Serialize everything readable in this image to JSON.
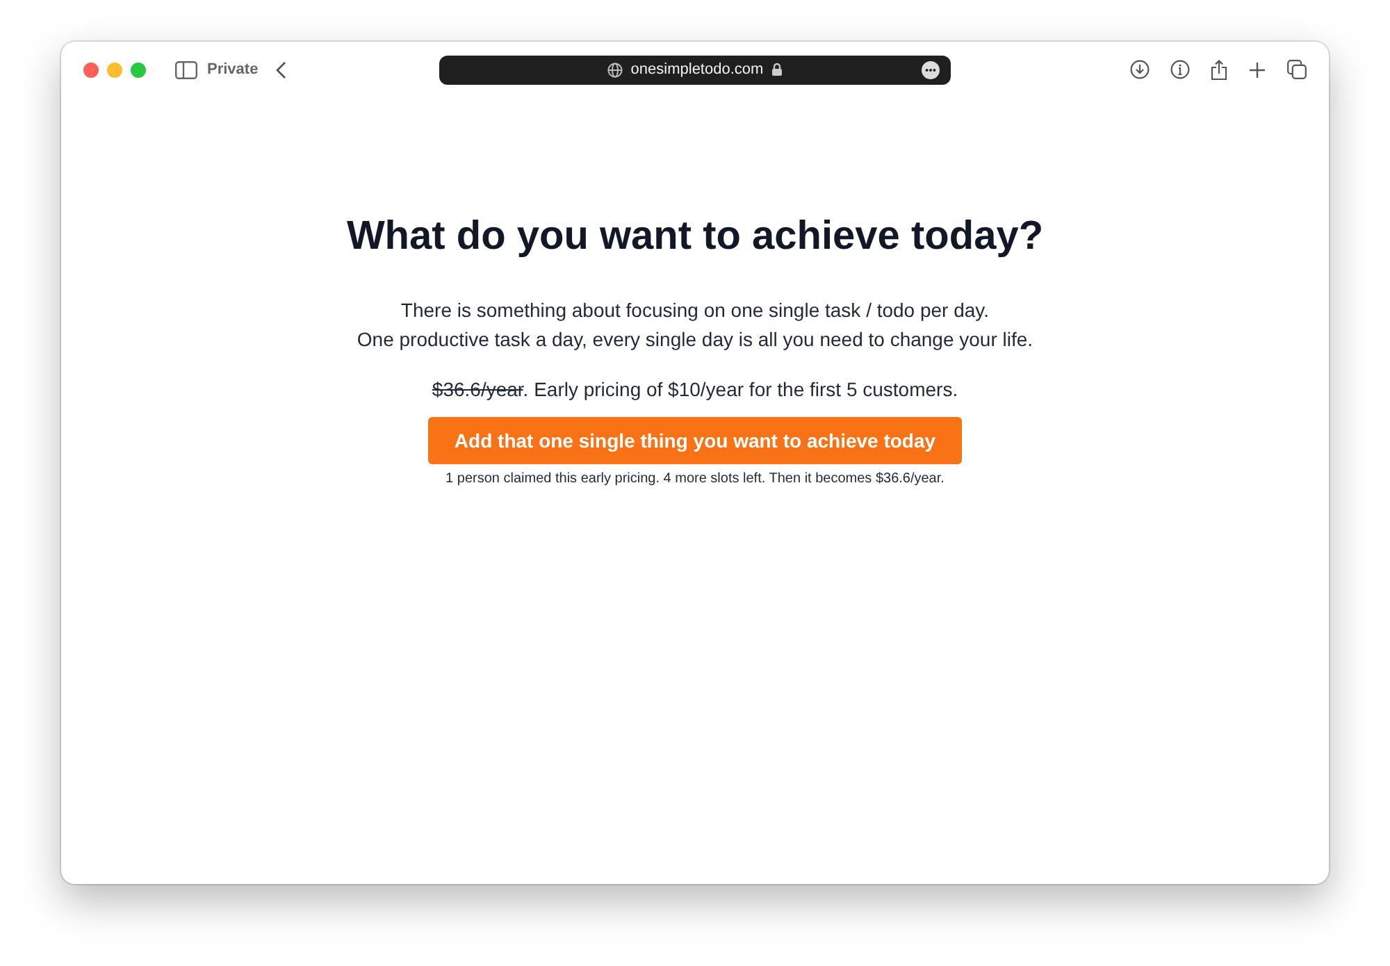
{
  "browser": {
    "private_label": "Private",
    "url": "onesimpletodo.com"
  },
  "page": {
    "heading": "What do you want to achieve today?",
    "intro": [
      "There is something about focusing on one single task / todo per day.",
      "One productive task a day, every single day is all you need to change your life."
    ],
    "pricing": {
      "old_price": "$36.6/year",
      "text": ". Early pricing of $10/year for the first 5 customers."
    },
    "cta_button": "Add that one single thing you want to achieve today",
    "note": "1 person claimed this early pricing. 4 more slots left. Then it becomes $36.6/year."
  }
}
